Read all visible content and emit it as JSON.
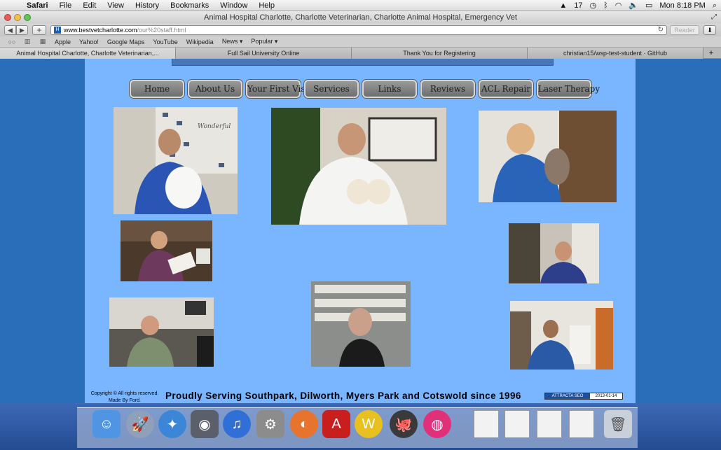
{
  "menubar": {
    "app_name": "Safari",
    "items": [
      "File",
      "Edit",
      "View",
      "History",
      "Bookmarks",
      "Window",
      "Help"
    ],
    "status": {
      "adobe": "17",
      "clock": "Mon 8:18 PM"
    }
  },
  "window": {
    "title": "Animal Hospital Charlotte, Charlotte Veterinarian, Charlotte Animal Hospital, Emergency Vet"
  },
  "toolbar": {
    "url_domain": "www.bestvetcharlotte.com",
    "url_path": "/our%20staff.html",
    "reader_label": "Reader",
    "add_tab": "+"
  },
  "bookmarks": [
    {
      "label": "Apple",
      "dropdown": false
    },
    {
      "label": "Yahoo!",
      "dropdown": false
    },
    {
      "label": "Google Maps",
      "dropdown": false
    },
    {
      "label": "YouTube",
      "dropdown": false
    },
    {
      "label": "Wikipedia",
      "dropdown": false
    },
    {
      "label": "News ▾",
      "dropdown": true
    },
    {
      "label": "Popular ▾",
      "dropdown": true
    }
  ],
  "tabs": [
    {
      "label": "Animal Hospital Charlotte, Charlotte Veterinarian,...",
      "active": true
    },
    {
      "label": "Full Sail University Online",
      "active": false
    },
    {
      "label": "Thank You for Registering",
      "active": false
    },
    {
      "label": "christian15/wsp-test-student · GitHub",
      "active": false
    }
  ],
  "nav": [
    {
      "label": "Home",
      "name": "nav-home-button"
    },
    {
      "label": "About Us",
      "name": "nav-about-us-button"
    },
    {
      "label": "Your First Visit",
      "name": "nav-your-first-visit-button"
    },
    {
      "label": "Services",
      "name": "nav-services-button"
    },
    {
      "label": "Links",
      "name": "nav-links-button"
    },
    {
      "label": "Reviews",
      "name": "nav-reviews-button"
    },
    {
      "label": "ACL Repair",
      "name": "nav-acl-repair-button"
    },
    {
      "label": "Laser Therapy",
      "name": "nav-laser-therapy-button"
    }
  ],
  "footer": {
    "copyright_line1": "Copyright © All rights reserved.",
    "copyright_line2": "Made By Ford.",
    "tagline": "Proudly Serving Southpark, Dilworth, Myers Park and Cotswold since 1996",
    "seo_badge_name": "ATTRACTA SEO",
    "seo_badge_date": "2013-01-14"
  },
  "colors": {
    "page_bg": "#79b6ff",
    "outer_bg": "#2a6db8",
    "nav_button": "#808080"
  }
}
